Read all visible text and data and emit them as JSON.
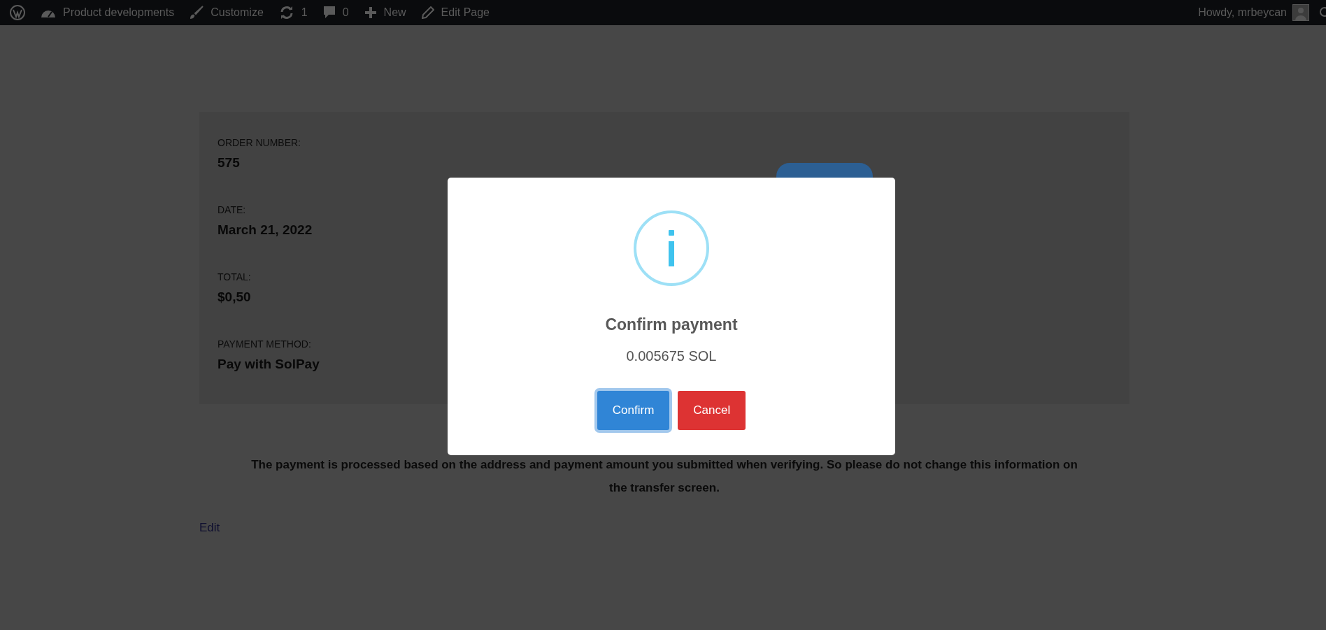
{
  "admin_bar": {
    "items": [
      {
        "kind": "logo"
      },
      {
        "kind": "site",
        "label": "Product developments"
      },
      {
        "kind": "customize",
        "label": "Customize"
      },
      {
        "kind": "updates",
        "label": "1"
      },
      {
        "kind": "comments",
        "label": "0"
      },
      {
        "kind": "new",
        "label": "New"
      },
      {
        "kind": "edit",
        "label": "Edit Page"
      }
    ],
    "account": {
      "label": "Howdy, mrbeycan"
    }
  },
  "order_details": [
    {
      "label": "ORDER NUMBER:",
      "value": "575"
    },
    {
      "label": "DATE:",
      "value": "March 21, 2022"
    },
    {
      "label": "TOTAL:",
      "value": "$0,50"
    },
    {
      "label": "PAYMENT METHOD:",
      "value": "Pay with SolPay"
    }
  ],
  "notice": "The payment is processed based on the address and payment amount you submitted when verifying. So please do not change this information on the transfer screen.",
  "edit_link": "Edit",
  "modal": {
    "title": "Confirm payment",
    "amount": "0.005675 SOL",
    "buttons": [
      {
        "label": "Confirm",
        "kind": "primary",
        "focused": true
      },
      {
        "label": "Cancel",
        "kind": "danger",
        "focused": false
      }
    ]
  }
}
